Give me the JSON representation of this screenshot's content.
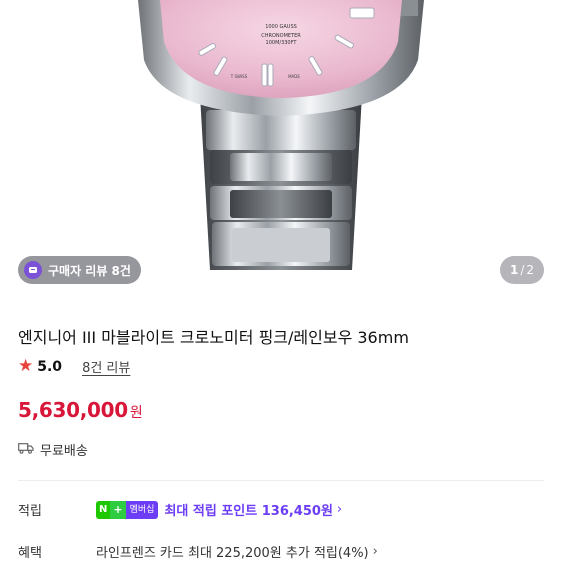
{
  "gallery": {
    "review_chip_label": "구매자 리뷰 8건",
    "pager_current": "1",
    "pager_separator": "/",
    "pager_total": "2",
    "dial_text": {
      "line1": "1000 GAUSS",
      "line2": "CHRONOMETER",
      "line3": "100M/330FT",
      "swiss": "T SWISS",
      "made": "MADE"
    },
    "dial_color": "#f0c8d8"
  },
  "product": {
    "title": "엔지니어 III 마블라이트 크로노미터 핑크/레인보우 36mm",
    "rating_score": "5.0",
    "review_link": "8건 리뷰",
    "price_amount": "5,630,000",
    "price_unit": "원",
    "shipping": "무료배송"
  },
  "details": {
    "points_label": "적립",
    "badge_n": "N",
    "badge_plus": "+",
    "badge_member": "멤버십",
    "points_text": "최대 적립 포인트 136,450원",
    "benefit_label": "혜택",
    "benefit_text": "라인프렌즈 카드 최대 225,200원 추가 적립(4%)"
  },
  "colors": {
    "price": "#d8163a",
    "star": "#e8433b",
    "membership": "#6c3df4",
    "naver_green": "#1ec800"
  },
  "icons": {
    "chip": "review-badge-icon",
    "star": "star-icon",
    "truck": "truck-icon",
    "chevron": "chevron-right-icon"
  }
}
